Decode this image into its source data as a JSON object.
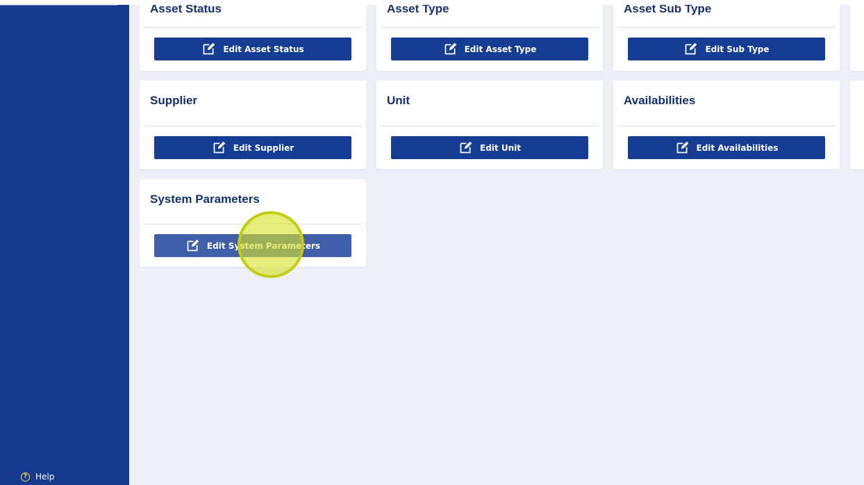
{
  "sidebar": {
    "help_label": "Help",
    "help_icon": "question-circle-icon"
  },
  "cards": [
    {
      "title": "Asset Status",
      "button_label": "Edit Asset Status"
    },
    {
      "title": "Asset Type",
      "button_label": "Edit Asset Type"
    },
    {
      "title": "Asset Sub Type",
      "button_label": "Edit Sub Type"
    },
    {
      "title": "Supplier",
      "button_label": "Edit Supplier"
    },
    {
      "title": "Unit",
      "button_label": "Edit Unit"
    },
    {
      "title": "Availabilities",
      "button_label": "Edit Availabilities"
    },
    {
      "title": "System Parameters",
      "button_label": "Edit System Parameters"
    }
  ],
  "colors": {
    "sidebar": "#153a8c",
    "button": "#163d94",
    "title": "#14306f",
    "background": "#edf0f7",
    "cursor_highlight": "#d7e228"
  }
}
